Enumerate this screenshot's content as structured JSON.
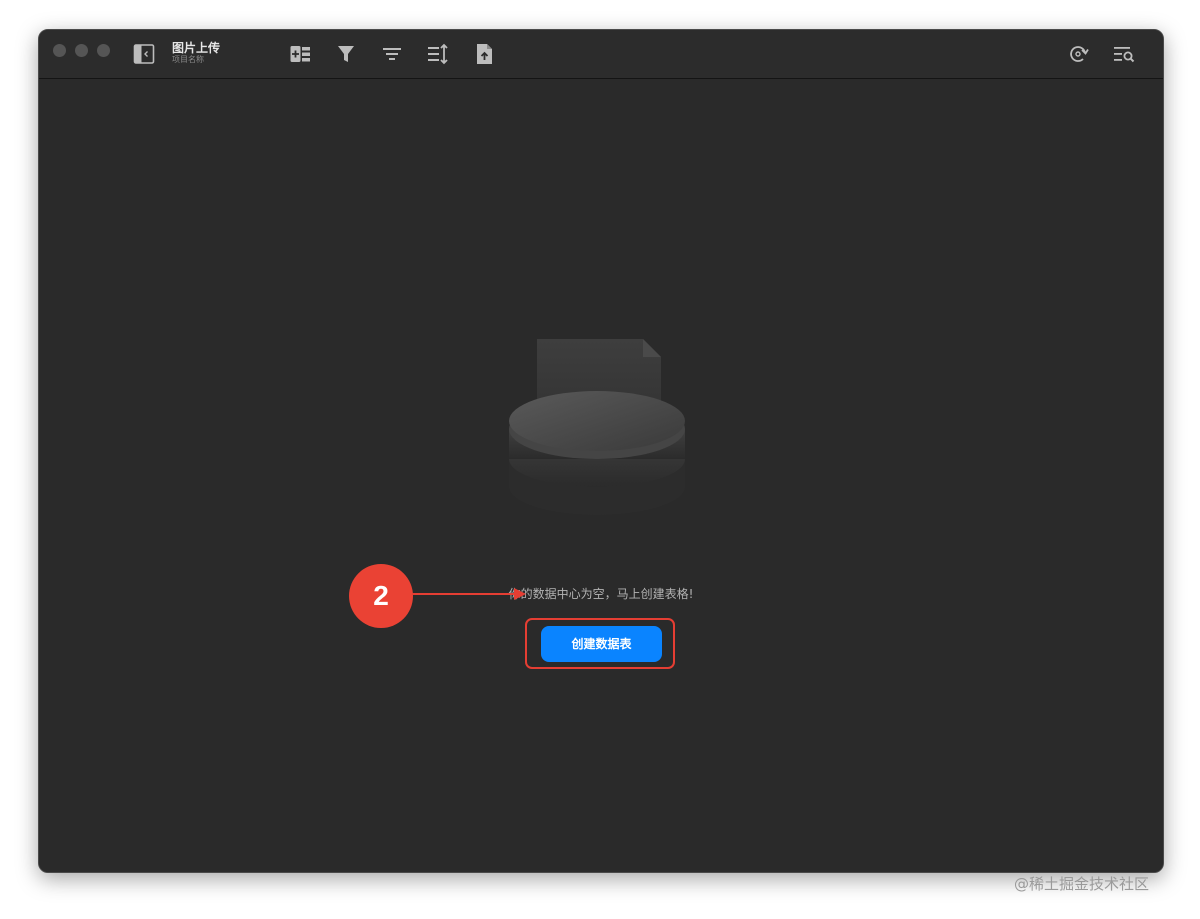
{
  "window": {
    "title": "图片上传",
    "subtitle": "项目名称"
  },
  "toolbar": {
    "icons": [
      "sidebar-toggle-icon",
      "add-field-icon",
      "filter-icon",
      "group-icon",
      "sort-icon",
      "upload-file-icon",
      "sync-icon",
      "search-list-icon"
    ]
  },
  "empty_state": {
    "message": "你的数据中心为空，马上创建表格!",
    "button_label": "创建数据表"
  },
  "annotation": {
    "step_number": "2",
    "color": "#e53e33"
  },
  "watermark": "@稀土掘金技术社区",
  "colors": {
    "accent": "#0a84ff",
    "background": "#2a2a2a"
  }
}
